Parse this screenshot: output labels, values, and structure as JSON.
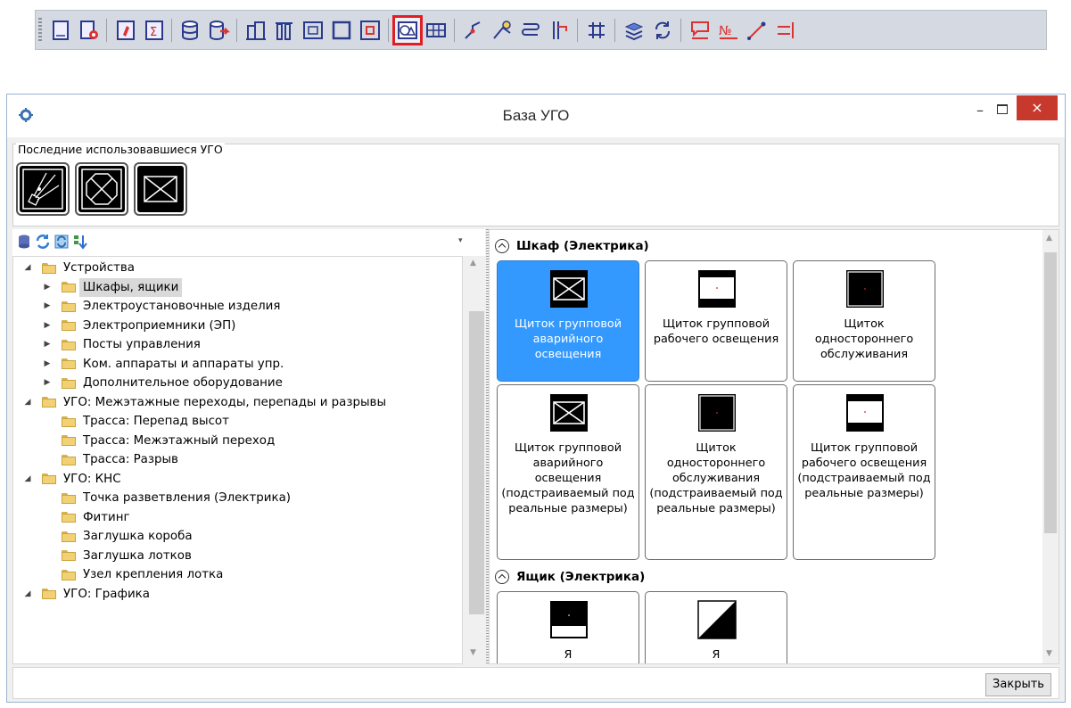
{
  "toolbar": {
    "icons": [
      "sheet-icon",
      "sheet-settings-icon",
      "edit-spec-icon",
      "sum-spec-icon",
      "database-icon",
      "database-export-icon",
      "building-icon",
      "columns-icon",
      "room-icon",
      "rectangle-icon",
      "room-fixed-icon",
      "ugo-base-icon",
      "grid-icon",
      "line-route-icon",
      "cable-icon",
      "wave-icon",
      "riser-icon",
      "terminal-icon",
      "stack-icon",
      "sync-icon",
      "label-icon",
      "numbering-icon",
      "measure-icon",
      "align-icon"
    ],
    "active_icon": "ugo-base-icon"
  },
  "window": {
    "title": "База УГО",
    "close_glyph": "×",
    "minimize_glyph": "–"
  },
  "recent": {
    "legend": "Последние использовавшиеся УГО",
    "items": [
      "route-symbol-icon",
      "octagon-symbol-icon",
      "panel-symbol-icon"
    ]
  },
  "tree": {
    "toolbar_icons": [
      "database-icon",
      "refresh-icon",
      "refresh-all-icon",
      "sort-icon"
    ],
    "items": [
      {
        "label": "Устройства",
        "level": 0,
        "expanded": true,
        "arrow": "◢"
      },
      {
        "label": "Шкафы, ящики",
        "level": 1,
        "arrow": "▶",
        "selected": true
      },
      {
        "label": "Электроустановочные изделия",
        "level": 1,
        "arrow": "▶"
      },
      {
        "label": "Электроприемники (ЭП)",
        "level": 1,
        "arrow": "▶"
      },
      {
        "label": "Посты управления",
        "level": 1,
        "arrow": "▶"
      },
      {
        "label": "Ком. аппараты и аппараты упр.",
        "level": 1,
        "arrow": "▶"
      },
      {
        "label": "Дополнительное оборудование",
        "level": 1,
        "arrow": "▶"
      },
      {
        "label": "УГО: Межэтажные переходы, перепады и разрывы",
        "level": 0,
        "arrow": "◢"
      },
      {
        "label": "Трасса: Перепад высот",
        "level": 1,
        "arrow": ""
      },
      {
        "label": "Трасса: Межэтажный переход",
        "level": 1,
        "arrow": ""
      },
      {
        "label": "Трасса: Разрыв",
        "level": 1,
        "arrow": ""
      },
      {
        "label": "УГО: КНС",
        "level": 0,
        "arrow": "◢"
      },
      {
        "label": "Точка разветвления (Электрика)",
        "level": 1,
        "arrow": ""
      },
      {
        "label": "Фитинг",
        "level": 1,
        "arrow": ""
      },
      {
        "label": "Заглушка короба",
        "level": 1,
        "arrow": ""
      },
      {
        "label": "Заглушка лотков",
        "level": 1,
        "arrow": ""
      },
      {
        "label": "Узел крепления лотка",
        "level": 1,
        "arrow": ""
      },
      {
        "label": "УГО: Графика",
        "level": 0,
        "arrow": "◢"
      }
    ]
  },
  "gallery": {
    "categories": [
      {
        "title": "Шкаф (Электрика)",
        "tiles": [
          {
            "label": "Щиток групповой аварийного освещения",
            "thumb": "cross-box",
            "selected": true
          },
          {
            "label": "Щиток групповой рабочего освещения",
            "thumb": "band-box"
          },
          {
            "label": "Щиток одностороннего обслуживания",
            "thumb": "solid-box"
          },
          {
            "label": "Щиток групповой аварийного освещения (подстраиваемый под реальные размеры)",
            "thumb": "cross-box"
          },
          {
            "label": "Щиток одностороннего обслуживания (подстраиваемый под реальные размеры)",
            "thumb": "solid-box"
          },
          {
            "label": "Щиток групповой рабочего освещения (подстраиваемый под реальные размеры)",
            "thumb": "band-box"
          }
        ]
      },
      {
        "title": "Ящик (Электрика)",
        "tiles": [
          {
            "label": "Я",
            "thumb": "bottom-box"
          },
          {
            "label": "Я",
            "thumb": "diagonal-box"
          }
        ]
      }
    ]
  },
  "footer": {
    "close_label": "Закрыть"
  },
  "colors": {
    "selection": "#3399ff",
    "close_button": "#c7392d",
    "active_outline": "#e01e25"
  }
}
